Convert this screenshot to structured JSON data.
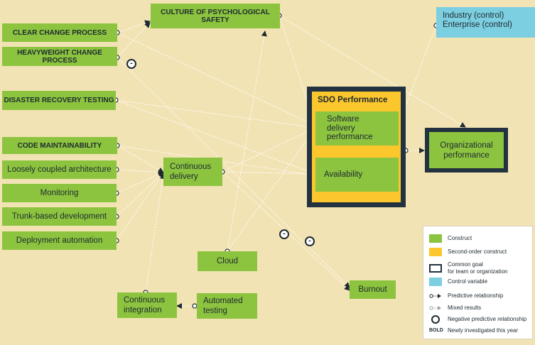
{
  "colors": {
    "background": "#f2e3b4",
    "construct": "#8cc43f",
    "second_order": "#fcc72d",
    "goal_border": "#233240",
    "control": "#7ccfe0",
    "text": "#1f2a30"
  },
  "nodes": {
    "culture": "CULTURE OF PSYCHOLOGICAL SAFETY",
    "clear_change": "CLEAR CHANGE PROCESS",
    "heavyweight_change": "HEAVYWEIGHT CHANGE PROCESS",
    "disaster_recovery": "DISASTER RECOVERY TESTING",
    "code_maintainability": "CODE MAINTAINABILITY",
    "loosely_coupled": "Loosely coupled architecture",
    "monitoring": "Monitoring",
    "trunk_based": "Trunk-based development",
    "deployment_automation": "Deployment automation",
    "continuous_delivery": [
      "Continuous",
      "delivery"
    ],
    "cloud": "Cloud",
    "continuous_integration": [
      "Continuous",
      "integration"
    ],
    "automated_testing": [
      "Automated",
      "testing"
    ],
    "burnout": "Burnout",
    "sdo_title": "SDO Performance",
    "software_delivery": [
      "Software",
      "delivery",
      "performance"
    ],
    "availability": "Availability",
    "organizational": [
      "Organizational",
      "performance"
    ],
    "control": [
      "Industry (control)",
      "Enterprise (control)"
    ]
  },
  "negative_marker": "-",
  "legend": {
    "construct": "Construct",
    "second_order": "Second-order construct",
    "common_goal": [
      "Common goal",
      "for team or organization"
    ],
    "control_variable": "Control variable",
    "predictive": "Predictive relationship",
    "mixed": "Mixed results",
    "negative": "Negative predictive relationship",
    "bold_key": "BOLD",
    "bold_desc": "Newly investigated this year"
  }
}
